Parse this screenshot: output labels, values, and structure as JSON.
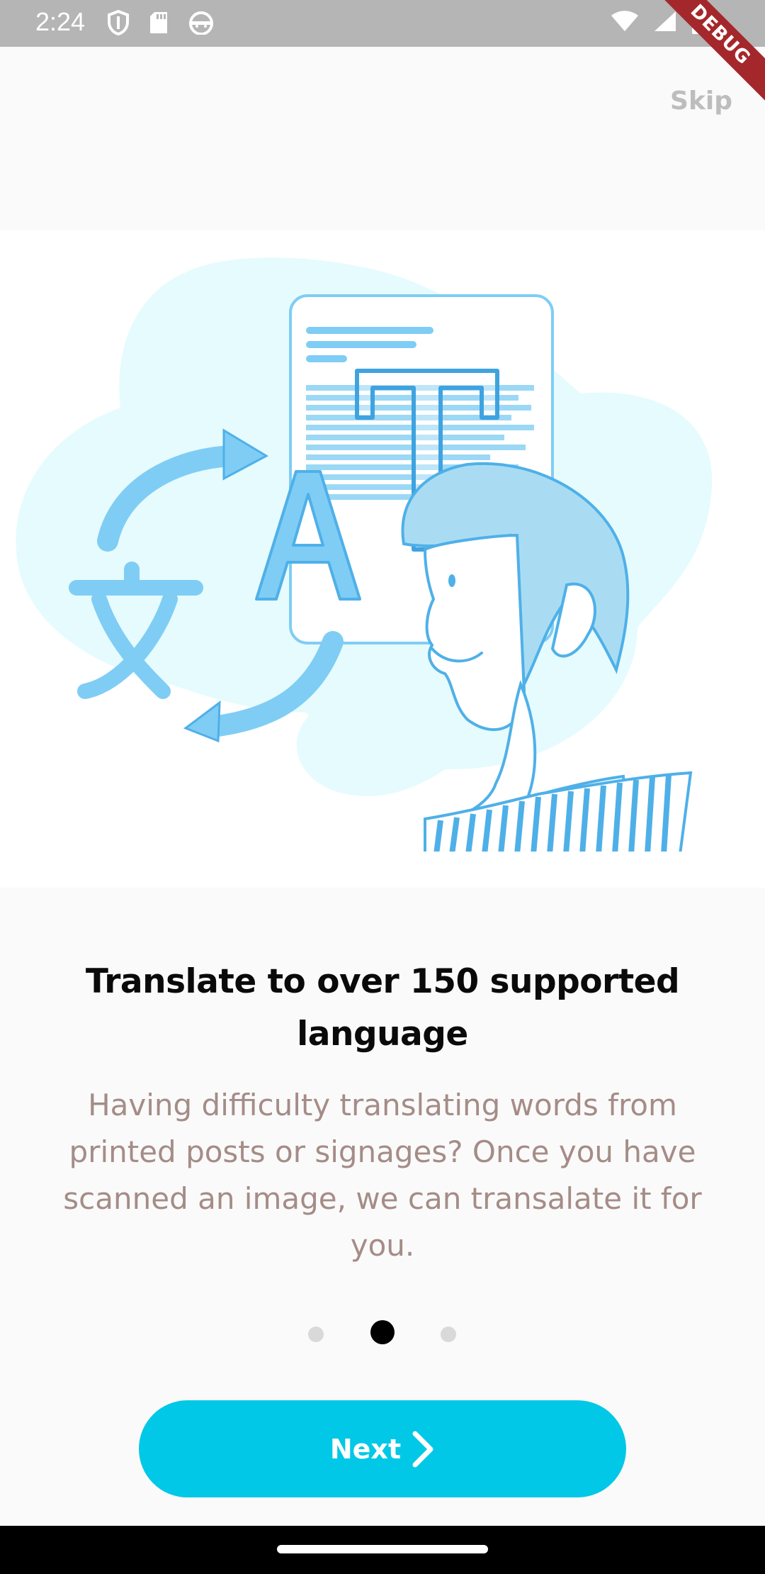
{
  "status_bar": {
    "time": "2:24",
    "left_icons": [
      "shield-icon",
      "sd-card-icon",
      "android-face-icon"
    ],
    "right_icons": [
      "wifi-icon",
      "signal-icon",
      "battery-icon"
    ]
  },
  "debug_banner": {
    "label": "DEBUG"
  },
  "header": {
    "skip_label": "Skip"
  },
  "onboarding": {
    "illustration": "translate-illustration",
    "title": "Translate to over 150 supported language",
    "description": "Having difficulty translating words from printed posts or signages? Once you have scanned an image, we can transalate it for you.",
    "page_indicator": {
      "total": 3,
      "active_index": 1
    }
  },
  "footer": {
    "next_label": "Next",
    "next_icon": "chevron-right-icon"
  },
  "colors": {
    "accent": "#00c8e6",
    "title": "#0a0a0a",
    "description": "#a58c87",
    "skip": "#bdbdbd",
    "illustration_blue": "#7fcdf5",
    "illustration_light": "#e6fbfd"
  }
}
